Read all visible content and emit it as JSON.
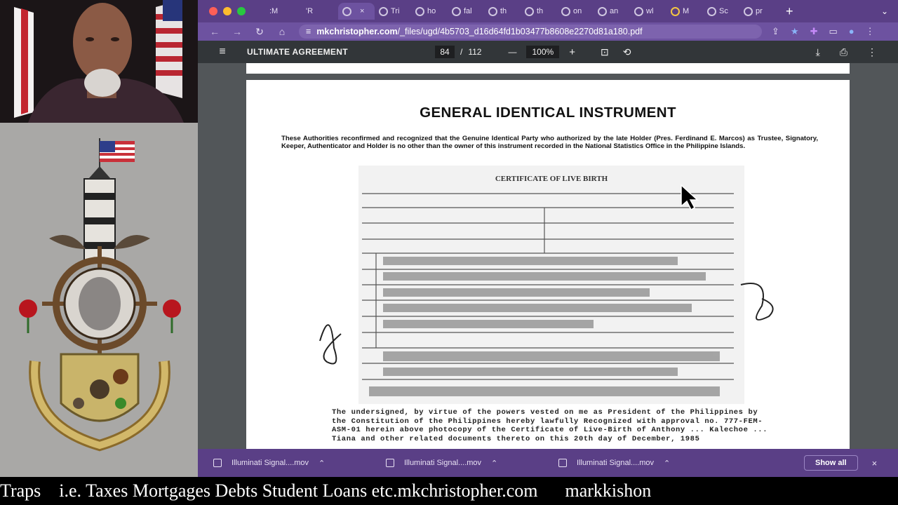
{
  "browser": {
    "tabs": [
      {
        "label": ":M",
        "active": false
      },
      {
        "label": "'R",
        "active": false
      },
      {
        "label": "",
        "active": true
      },
      {
        "label": "Tri",
        "active": false
      },
      {
        "label": "ho",
        "active": false
      },
      {
        "label": "fal",
        "active": false
      },
      {
        "label": "th",
        "active": false
      },
      {
        "label": "th",
        "active": false
      },
      {
        "label": "on",
        "active": false
      },
      {
        "label": "an",
        "active": false
      },
      {
        "label": "wl",
        "active": false
      },
      {
        "label": "M",
        "active": false
      },
      {
        "label": "Sc",
        "active": false
      },
      {
        "label": "pr",
        "active": false
      }
    ],
    "active_tab_close": "×",
    "new_tab_icon": "+",
    "tab_menu_icon": "⌄",
    "url_host": "mkchristopher.com",
    "url_path": "/_files/ugd/4b5703_d16d64fd1b03477b8608e2270d81a180.pdf",
    "colors": {
      "chrome_purple": "#5a3f86",
      "toolbar_purple": "#6d52a0",
      "pdf_toolbar": "#323639",
      "pdf_bg": "#525659"
    }
  },
  "pdf_toolbar": {
    "menu_icon": "≡",
    "title": "ULTIMATE AGREEMENT",
    "current_page": "84",
    "page_separator": "/",
    "total_pages": "112",
    "zoom_out": "—",
    "zoom": "100%",
    "zoom_in": "+",
    "download_icon": "⤓",
    "print_icon": "⎙",
    "more_icon": "⋮"
  },
  "document": {
    "title": "GENERAL IDENTICAL INSTRUMENT",
    "paragraph": "These Authorities reconfirmed and recognized that the Genuine Identical Party who authorized by the late Holder (Pres. Ferdinand E. Marcos) as Trustee, Signatory, Keeper, Authenticator and Holder is no other than the owner of this instrument recorded in the National Statistics Office in the Philippine Islands.",
    "certificate_heading": "CERTIFICATE OF LIVE BIRTH",
    "caption": "The undersigned, by virtue of the powers vested on me as President of the Philippines by the Constitution of the Philippines hereby lawfully Recognized with approval no. 777-FEM-ASM-01 herein above photocopy of the Certificate of Live-Birth of Anthony ... Kalechoe ... Tiana and other related documents thereto on this 20th day of December, 1985"
  },
  "downloads": {
    "items": [
      "Illuminati Signal....mov",
      "Illuminati Signal....mov",
      "Illuminati Signal....mov"
    ],
    "show_all": "Show all",
    "close_icon": "×"
  },
  "ticker": {
    "text": "Traps    i.e. Taxes Mortgages Debts Student Loans etc.mkchristopher.com      markkishon"
  }
}
